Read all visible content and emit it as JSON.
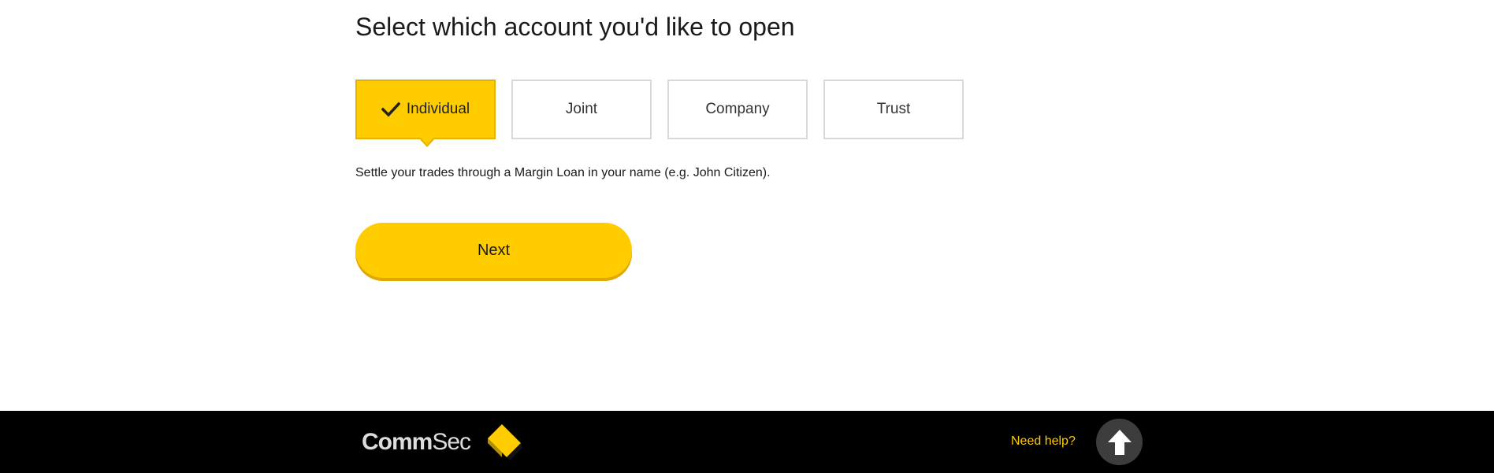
{
  "page": {
    "title": "Select which account you'd like to open"
  },
  "account_types": {
    "options": [
      {
        "label": "Individual",
        "selected": true
      },
      {
        "label": "Joint",
        "selected": false
      },
      {
        "label": "Company",
        "selected": false
      },
      {
        "label": "Trust",
        "selected": false
      }
    ],
    "description": "Settle your trades through a Margin Loan in your name (e.g. John Citizen)."
  },
  "actions": {
    "next_label": "Next"
  },
  "footer": {
    "logo_bold": "Comm",
    "logo_light": "Sec",
    "help_label": "Need help?",
    "help_icon": "arrow-up-icon"
  },
  "colors": {
    "accent": "#ffcc00",
    "footer_bg": "#000000",
    "help_button_bg": "#3d3d3d"
  }
}
